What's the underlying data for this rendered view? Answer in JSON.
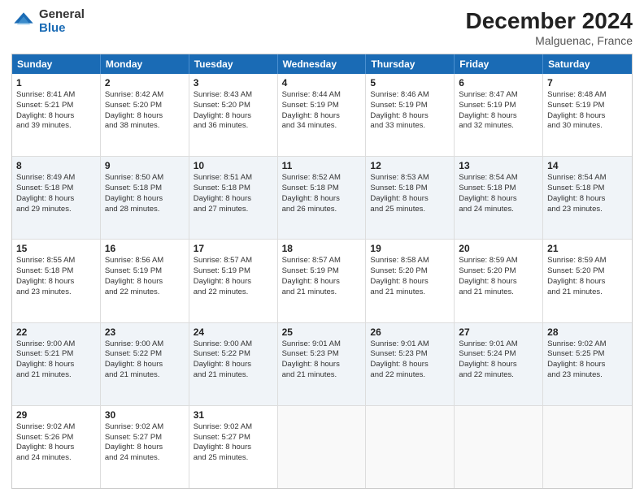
{
  "logo": {
    "general": "General",
    "blue": "Blue"
  },
  "title": "December 2024",
  "subtitle": "Malguenac, France",
  "header_days": [
    "Sunday",
    "Monday",
    "Tuesday",
    "Wednesday",
    "Thursday",
    "Friday",
    "Saturday"
  ],
  "rows": [
    {
      "shaded": false,
      "cells": [
        {
          "day": "1",
          "info": "Sunrise: 8:41 AM\nSunset: 5:21 PM\nDaylight: 8 hours\nand 39 minutes."
        },
        {
          "day": "2",
          "info": "Sunrise: 8:42 AM\nSunset: 5:20 PM\nDaylight: 8 hours\nand 38 minutes."
        },
        {
          "day": "3",
          "info": "Sunrise: 8:43 AM\nSunset: 5:20 PM\nDaylight: 8 hours\nand 36 minutes."
        },
        {
          "day": "4",
          "info": "Sunrise: 8:44 AM\nSunset: 5:19 PM\nDaylight: 8 hours\nand 34 minutes."
        },
        {
          "day": "5",
          "info": "Sunrise: 8:46 AM\nSunset: 5:19 PM\nDaylight: 8 hours\nand 33 minutes."
        },
        {
          "day": "6",
          "info": "Sunrise: 8:47 AM\nSunset: 5:19 PM\nDaylight: 8 hours\nand 32 minutes."
        },
        {
          "day": "7",
          "info": "Sunrise: 8:48 AM\nSunset: 5:19 PM\nDaylight: 8 hours\nand 30 minutes."
        }
      ]
    },
    {
      "shaded": true,
      "cells": [
        {
          "day": "8",
          "info": "Sunrise: 8:49 AM\nSunset: 5:18 PM\nDaylight: 8 hours\nand 29 minutes."
        },
        {
          "day": "9",
          "info": "Sunrise: 8:50 AM\nSunset: 5:18 PM\nDaylight: 8 hours\nand 28 minutes."
        },
        {
          "day": "10",
          "info": "Sunrise: 8:51 AM\nSunset: 5:18 PM\nDaylight: 8 hours\nand 27 minutes."
        },
        {
          "day": "11",
          "info": "Sunrise: 8:52 AM\nSunset: 5:18 PM\nDaylight: 8 hours\nand 26 minutes."
        },
        {
          "day": "12",
          "info": "Sunrise: 8:53 AM\nSunset: 5:18 PM\nDaylight: 8 hours\nand 25 minutes."
        },
        {
          "day": "13",
          "info": "Sunrise: 8:54 AM\nSunset: 5:18 PM\nDaylight: 8 hours\nand 24 minutes."
        },
        {
          "day": "14",
          "info": "Sunrise: 8:54 AM\nSunset: 5:18 PM\nDaylight: 8 hours\nand 23 minutes."
        }
      ]
    },
    {
      "shaded": false,
      "cells": [
        {
          "day": "15",
          "info": "Sunrise: 8:55 AM\nSunset: 5:18 PM\nDaylight: 8 hours\nand 23 minutes."
        },
        {
          "day": "16",
          "info": "Sunrise: 8:56 AM\nSunset: 5:19 PM\nDaylight: 8 hours\nand 22 minutes."
        },
        {
          "day": "17",
          "info": "Sunrise: 8:57 AM\nSunset: 5:19 PM\nDaylight: 8 hours\nand 22 minutes."
        },
        {
          "day": "18",
          "info": "Sunrise: 8:57 AM\nSunset: 5:19 PM\nDaylight: 8 hours\nand 21 minutes."
        },
        {
          "day": "19",
          "info": "Sunrise: 8:58 AM\nSunset: 5:20 PM\nDaylight: 8 hours\nand 21 minutes."
        },
        {
          "day": "20",
          "info": "Sunrise: 8:59 AM\nSunset: 5:20 PM\nDaylight: 8 hours\nand 21 minutes."
        },
        {
          "day": "21",
          "info": "Sunrise: 8:59 AM\nSunset: 5:20 PM\nDaylight: 8 hours\nand 21 minutes."
        }
      ]
    },
    {
      "shaded": true,
      "cells": [
        {
          "day": "22",
          "info": "Sunrise: 9:00 AM\nSunset: 5:21 PM\nDaylight: 8 hours\nand 21 minutes."
        },
        {
          "day": "23",
          "info": "Sunrise: 9:00 AM\nSunset: 5:22 PM\nDaylight: 8 hours\nand 21 minutes."
        },
        {
          "day": "24",
          "info": "Sunrise: 9:00 AM\nSunset: 5:22 PM\nDaylight: 8 hours\nand 21 minutes."
        },
        {
          "day": "25",
          "info": "Sunrise: 9:01 AM\nSunset: 5:23 PM\nDaylight: 8 hours\nand 21 minutes."
        },
        {
          "day": "26",
          "info": "Sunrise: 9:01 AM\nSunset: 5:23 PM\nDaylight: 8 hours\nand 22 minutes."
        },
        {
          "day": "27",
          "info": "Sunrise: 9:01 AM\nSunset: 5:24 PM\nDaylight: 8 hours\nand 22 minutes."
        },
        {
          "day": "28",
          "info": "Sunrise: 9:02 AM\nSunset: 5:25 PM\nDaylight: 8 hours\nand 23 minutes."
        }
      ]
    },
    {
      "shaded": false,
      "cells": [
        {
          "day": "29",
          "info": "Sunrise: 9:02 AM\nSunset: 5:26 PM\nDaylight: 8 hours\nand 24 minutes."
        },
        {
          "day": "30",
          "info": "Sunrise: 9:02 AM\nSunset: 5:27 PM\nDaylight: 8 hours\nand 24 minutes."
        },
        {
          "day": "31",
          "info": "Sunrise: 9:02 AM\nSunset: 5:27 PM\nDaylight: 8 hours\nand 25 minutes."
        },
        {
          "day": "",
          "info": ""
        },
        {
          "day": "",
          "info": ""
        },
        {
          "day": "",
          "info": ""
        },
        {
          "day": "",
          "info": ""
        }
      ]
    }
  ]
}
